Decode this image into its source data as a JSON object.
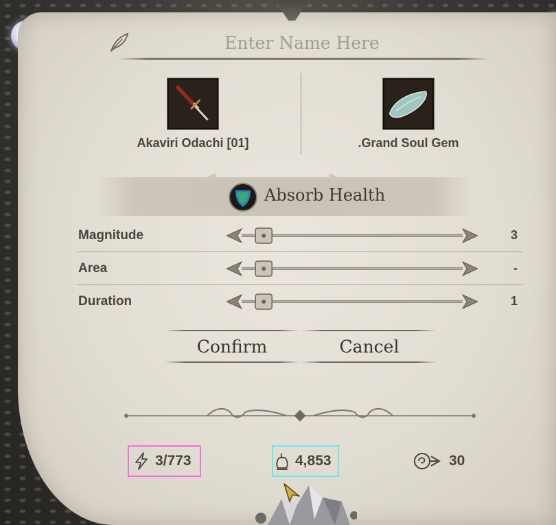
{
  "name_field": {
    "placeholder": "Enter Name Here",
    "value": ""
  },
  "items": {
    "weapon": {
      "label": "Akaviri Odachi [01]",
      "icon": "katana-icon"
    },
    "soul_gem": {
      "label": ".Grand Soul Gem",
      "icon": "soul-gem-icon"
    }
  },
  "effect": {
    "name": "Absorb Health",
    "icon": "absorb-health-icon"
  },
  "params": [
    {
      "label": "Magnitude",
      "value": "3",
      "level": 0.1
    },
    {
      "label": "Area",
      "value": "-",
      "level": 0.1
    },
    {
      "label": "Duration",
      "value": "1",
      "level": 0.1
    }
  ],
  "buttons": {
    "confirm": "Confirm",
    "cancel": "Cancel"
  },
  "stats": {
    "charge": {
      "value": "3/773",
      "icon": "lightning-icon"
    },
    "gold": {
      "value": "4,853",
      "icon": "gold-pouch-icon"
    },
    "souls": {
      "value": "30",
      "icon": "soul-arrow-icon"
    }
  },
  "colors": {
    "parchment": "#e2ddd3",
    "text": "#4a443d",
    "highlight_pink": "#f070e0",
    "highlight_cyan": "#6ee6ef"
  }
}
